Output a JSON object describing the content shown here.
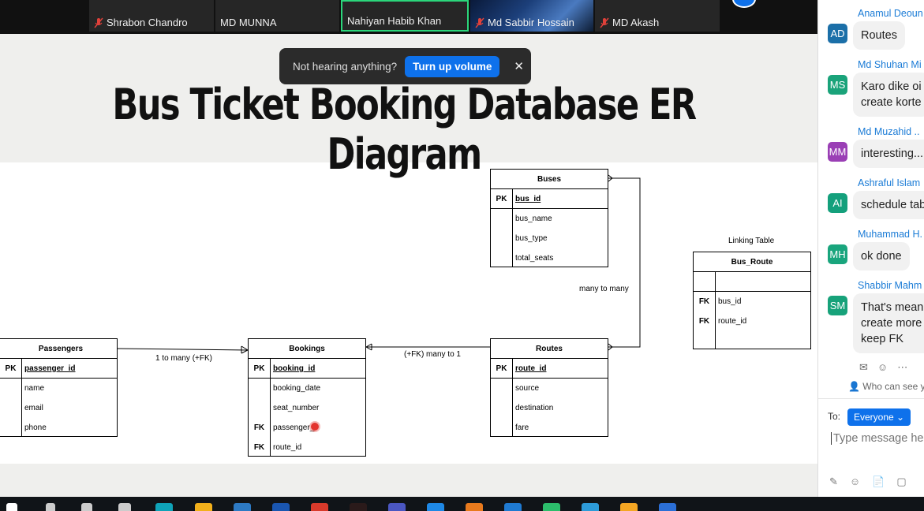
{
  "participants": [
    {
      "name": "Shrabon Chandro",
      "muted": true
    },
    {
      "name": "MD MUNNA",
      "muted": false
    },
    {
      "name": "Nahiyan Habib Khan",
      "muted": false,
      "active": true
    },
    {
      "name": "Md Sabbir Hossain",
      "muted": true
    },
    {
      "name": "MD Akash",
      "muted": true
    }
  ],
  "toast": {
    "message": "Not hearing anything?",
    "button_label": "Turn up volume",
    "close_glyph": "✕"
  },
  "slide": {
    "title": "Bus Ticket Booking Database ER Diagram"
  },
  "er": {
    "buses": {
      "name": "Buses",
      "pk_label": "PK",
      "pk_field": "bus_id",
      "fields": [
        "bus_name",
        "bus_type",
        "total_seats"
      ]
    },
    "passengers": {
      "name": "Passengers",
      "pk_label": "PK",
      "pk_field": "passenger_id",
      "fields": [
        "name",
        "email",
        "phone"
      ]
    },
    "bookings": {
      "name": "Bookings",
      "pk_label": "PK",
      "pk_field": "booking_id",
      "fields": [
        "booking_date",
        "seat_number"
      ],
      "fk_label": "FK",
      "fk_fields": [
        "passenger_",
        "route_id"
      ]
    },
    "routes": {
      "name": "Routes",
      "pk_label": "PK",
      "pk_field": "route_id",
      "fields": [
        "source",
        "destination",
        "fare"
      ]
    },
    "bus_route": {
      "caption": "Linking Table",
      "name": "Bus_Route",
      "fk_label": "FK",
      "fk_fields": [
        "bus_id",
        "route_id"
      ]
    },
    "relations": {
      "passengers_bookings": "1 to many (+FK)",
      "bookings_routes": "(+FK) many to 1",
      "routes_buses": "many to many"
    }
  },
  "chat": {
    "messages": [
      {
        "initials": "AD",
        "sender": "Anamul Deoun",
        "text_lines": [
          "Routes"
        ],
        "color": "#1b6fa8"
      },
      {
        "initials": "MS",
        "sender": "Md Shuhan Mi",
        "text_lines": [
          "Karo dike oi",
          "create korte"
        ],
        "color": "#1aa37a"
      },
      {
        "initials": "MM",
        "sender": "Md Muzahid ..",
        "text_lines": [
          "interesting..."
        ],
        "color": "#9a3fb5"
      },
      {
        "initials": "AI",
        "sender": "Ashraful Islam",
        "text_lines": [
          "schedule tab"
        ],
        "color": "#14a07c"
      },
      {
        "initials": "MH",
        "sender": "Muhammad H.",
        "text_lines": [
          "ok done"
        ],
        "color": "#19a57d"
      },
      {
        "initials": "SM",
        "sender": "Shabbir Mahm",
        "text_lines": [
          "That's mean",
          "create more",
          "keep FK"
        ],
        "color": "#17a27a"
      }
    ],
    "who_can_see": "Who can see yo",
    "to_label": "To:",
    "to_value": "Everyone",
    "input_placeholder": "Type message her"
  },
  "colors": {
    "accent": "#0e71eb",
    "active_speaker": "#2bd67b",
    "sender_name": "#1a7bd6",
    "muted_mic": "#e0413a"
  }
}
